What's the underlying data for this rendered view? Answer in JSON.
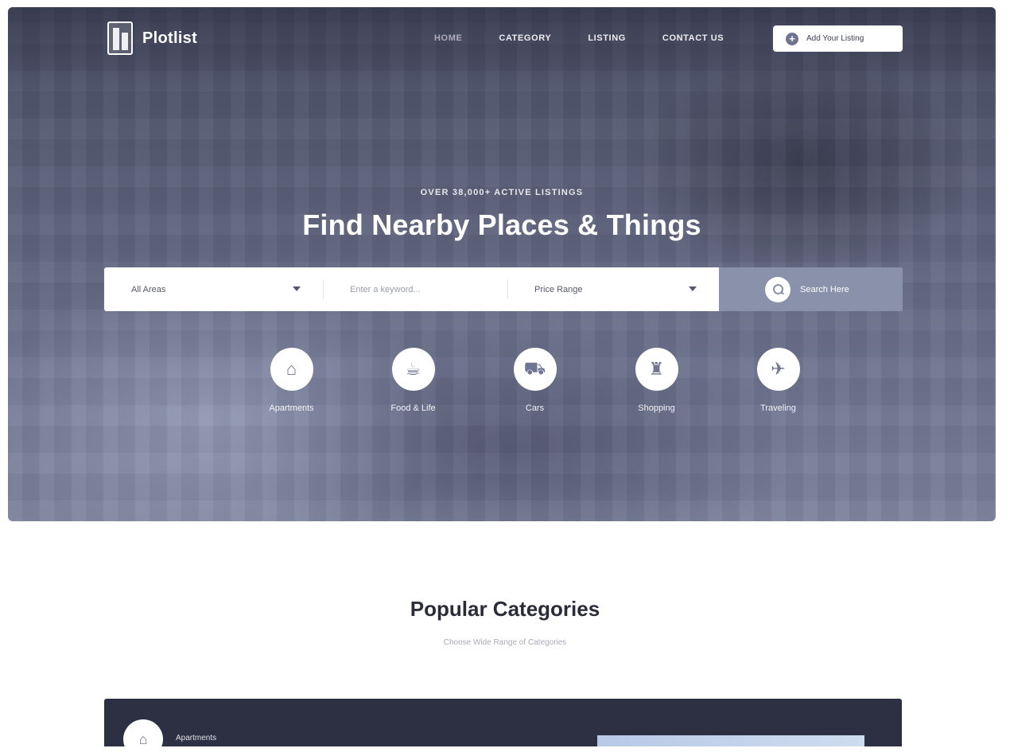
{
  "brand": {
    "name": "Plotlist"
  },
  "nav": {
    "items": [
      {
        "label": "HOME",
        "active": true
      },
      {
        "label": "CATEGORY",
        "active": false
      },
      {
        "label": "LISTING",
        "active": false
      },
      {
        "label": "CONTACT US",
        "active": false
      }
    ],
    "add_listing_label": "Add Your Listing"
  },
  "hero": {
    "eyebrow": "OVER 38,000+ ACTIVE LISTINGS",
    "headline": "Find Nearby Places & Things"
  },
  "search": {
    "area_value": "All Areas",
    "keyword_placeholder": "Enter a keyword...",
    "price_value": "Price Range",
    "button_label": "Search Here"
  },
  "categories": [
    {
      "label": "Apartments",
      "icon": "home-icon",
      "glyph": "⌂"
    },
    {
      "label": "Food & Life",
      "icon": "restaurant-icon",
      "glyph": "☕"
    },
    {
      "label": "Cars",
      "icon": "car-icon",
      "glyph": "⛟"
    },
    {
      "label": "Shopping",
      "icon": "shopping-bag-icon",
      "glyph": "♜"
    },
    {
      "label": "Traveling",
      "icon": "suitcase-icon",
      "glyph": "✈"
    }
  ],
  "popular": {
    "title": "Popular Categories",
    "subtitle": "Choose Wide Range of Categories",
    "first_card_label": "Apartments"
  },
  "colors": {
    "accent": "#8a91aa",
    "dark_band": "#2d2f42"
  }
}
